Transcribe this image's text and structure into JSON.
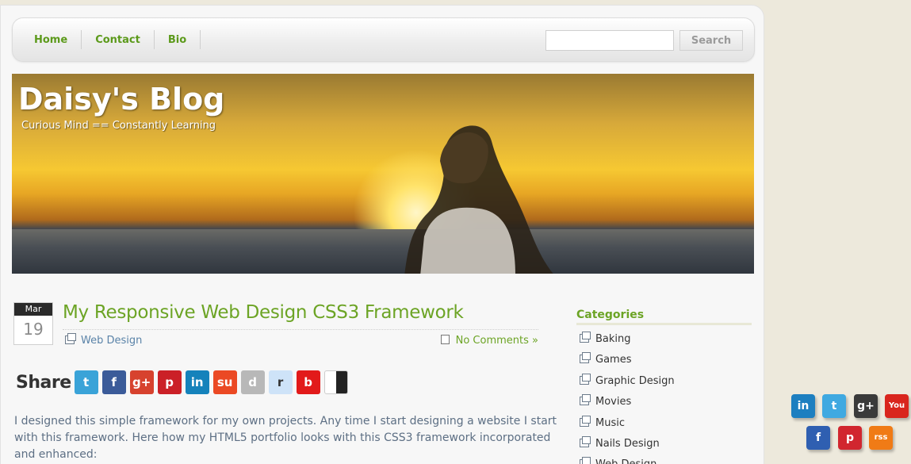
{
  "nav": {
    "items": [
      "Home",
      "Contact",
      "Bio"
    ],
    "search_placeholder": "",
    "search_button": "Search"
  },
  "header": {
    "title": "Daisy's Blog",
    "subtitle": "Curious Mind == Constantly Learning"
  },
  "post": {
    "month": "Mar",
    "day": "19",
    "title": "My Responsive Web Design CSS3 Framework",
    "category": "Web Design",
    "comments": "No Comments »",
    "share_label": "Share",
    "share_icons": [
      {
        "name": "twitter-icon",
        "glyph": "t",
        "color": "#3aa3d8"
      },
      {
        "name": "facebook-icon",
        "glyph": "f",
        "color": "#3b5b99"
      },
      {
        "name": "google-plus-icon",
        "glyph": "g+",
        "color": "#d7422e"
      },
      {
        "name": "pinterest-icon",
        "glyph": "p",
        "color": "#cb2027"
      },
      {
        "name": "linkedin-icon",
        "glyph": "in",
        "color": "#1582bb"
      },
      {
        "name": "stumbleupon-icon",
        "glyph": "su",
        "color": "#eb4924"
      },
      {
        "name": "digg-icon",
        "glyph": "d",
        "color": "#b8b8b8"
      },
      {
        "name": "reddit-icon",
        "glyph": "r",
        "color": "#cee3f8"
      },
      {
        "name": "bebo-icon",
        "glyph": "b",
        "color": "#e21a1a"
      },
      {
        "name": "delicious-icon",
        "glyph": "",
        "color": "#3274d1"
      }
    ],
    "body": "I designed this simple framework for my own projects. Any time I start designing a website I start with this framework. Here how my HTML5 portfolio looks with this CSS3 framework incorporated and enhanced:"
  },
  "sidebar": {
    "categories_title": "Categories",
    "categories": [
      "Baking",
      "Games",
      "Graphic Design",
      "Movies",
      "Music",
      "Nails Design",
      "Web Design"
    ]
  },
  "floating_social": [
    {
      "name": "linkedin-icon",
      "glyph": "in",
      "color": "#1d7fc0"
    },
    {
      "name": "twitter-icon",
      "glyph": "t",
      "color": "#3fa9e1"
    },
    {
      "name": "google-plus-icon",
      "glyph": "g+",
      "color": "#3a3a3a"
    },
    {
      "name": "youtube-icon",
      "glyph": "You",
      "color": "#d9251d"
    },
    {
      "name": "facebook-icon",
      "glyph": "f",
      "color": "#2f5fb1"
    },
    {
      "name": "pinterest-icon",
      "glyph": "p",
      "color": "#d1262f"
    },
    {
      "name": "rss-icon",
      "glyph": "rss",
      "color": "#f07b16"
    }
  ]
}
